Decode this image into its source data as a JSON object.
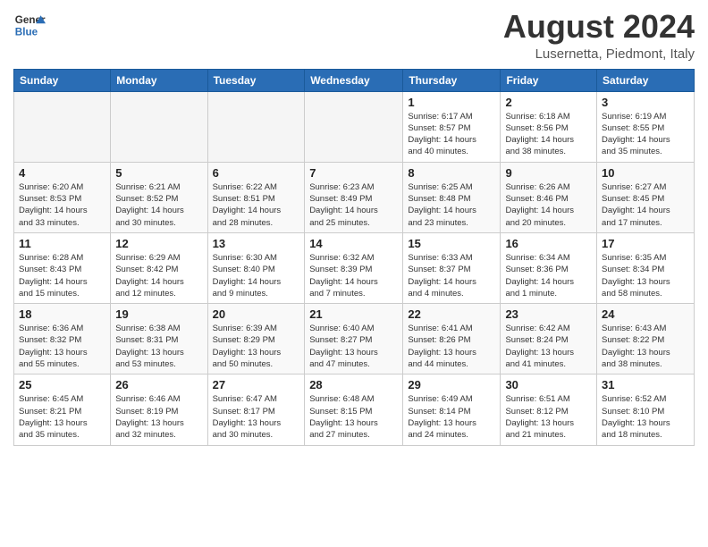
{
  "header": {
    "logo": {
      "line1": "General",
      "line2": "Blue"
    },
    "title": "August 2024",
    "location": "Lusernetta, Piedmont, Italy"
  },
  "weekdays": [
    "Sunday",
    "Monday",
    "Tuesday",
    "Wednesday",
    "Thursday",
    "Friday",
    "Saturday"
  ],
  "weeks": [
    [
      {
        "day": "",
        "info": ""
      },
      {
        "day": "",
        "info": ""
      },
      {
        "day": "",
        "info": ""
      },
      {
        "day": "",
        "info": ""
      },
      {
        "day": "1",
        "info": "Sunrise: 6:17 AM\nSunset: 8:57 PM\nDaylight: 14 hours\nand 40 minutes."
      },
      {
        "day": "2",
        "info": "Sunrise: 6:18 AM\nSunset: 8:56 PM\nDaylight: 14 hours\nand 38 minutes."
      },
      {
        "day": "3",
        "info": "Sunrise: 6:19 AM\nSunset: 8:55 PM\nDaylight: 14 hours\nand 35 minutes."
      }
    ],
    [
      {
        "day": "4",
        "info": "Sunrise: 6:20 AM\nSunset: 8:53 PM\nDaylight: 14 hours\nand 33 minutes."
      },
      {
        "day": "5",
        "info": "Sunrise: 6:21 AM\nSunset: 8:52 PM\nDaylight: 14 hours\nand 30 minutes."
      },
      {
        "day": "6",
        "info": "Sunrise: 6:22 AM\nSunset: 8:51 PM\nDaylight: 14 hours\nand 28 minutes."
      },
      {
        "day": "7",
        "info": "Sunrise: 6:23 AM\nSunset: 8:49 PM\nDaylight: 14 hours\nand 25 minutes."
      },
      {
        "day": "8",
        "info": "Sunrise: 6:25 AM\nSunset: 8:48 PM\nDaylight: 14 hours\nand 23 minutes."
      },
      {
        "day": "9",
        "info": "Sunrise: 6:26 AM\nSunset: 8:46 PM\nDaylight: 14 hours\nand 20 minutes."
      },
      {
        "day": "10",
        "info": "Sunrise: 6:27 AM\nSunset: 8:45 PM\nDaylight: 14 hours\nand 17 minutes."
      }
    ],
    [
      {
        "day": "11",
        "info": "Sunrise: 6:28 AM\nSunset: 8:43 PM\nDaylight: 14 hours\nand 15 minutes."
      },
      {
        "day": "12",
        "info": "Sunrise: 6:29 AM\nSunset: 8:42 PM\nDaylight: 14 hours\nand 12 minutes."
      },
      {
        "day": "13",
        "info": "Sunrise: 6:30 AM\nSunset: 8:40 PM\nDaylight: 14 hours\nand 9 minutes."
      },
      {
        "day": "14",
        "info": "Sunrise: 6:32 AM\nSunset: 8:39 PM\nDaylight: 14 hours\nand 7 minutes."
      },
      {
        "day": "15",
        "info": "Sunrise: 6:33 AM\nSunset: 8:37 PM\nDaylight: 14 hours\nand 4 minutes."
      },
      {
        "day": "16",
        "info": "Sunrise: 6:34 AM\nSunset: 8:36 PM\nDaylight: 14 hours\nand 1 minute."
      },
      {
        "day": "17",
        "info": "Sunrise: 6:35 AM\nSunset: 8:34 PM\nDaylight: 13 hours\nand 58 minutes."
      }
    ],
    [
      {
        "day": "18",
        "info": "Sunrise: 6:36 AM\nSunset: 8:32 PM\nDaylight: 13 hours\nand 55 minutes."
      },
      {
        "day": "19",
        "info": "Sunrise: 6:38 AM\nSunset: 8:31 PM\nDaylight: 13 hours\nand 53 minutes."
      },
      {
        "day": "20",
        "info": "Sunrise: 6:39 AM\nSunset: 8:29 PM\nDaylight: 13 hours\nand 50 minutes."
      },
      {
        "day": "21",
        "info": "Sunrise: 6:40 AM\nSunset: 8:27 PM\nDaylight: 13 hours\nand 47 minutes."
      },
      {
        "day": "22",
        "info": "Sunrise: 6:41 AM\nSunset: 8:26 PM\nDaylight: 13 hours\nand 44 minutes."
      },
      {
        "day": "23",
        "info": "Sunrise: 6:42 AM\nSunset: 8:24 PM\nDaylight: 13 hours\nand 41 minutes."
      },
      {
        "day": "24",
        "info": "Sunrise: 6:43 AM\nSunset: 8:22 PM\nDaylight: 13 hours\nand 38 minutes."
      }
    ],
    [
      {
        "day": "25",
        "info": "Sunrise: 6:45 AM\nSunset: 8:21 PM\nDaylight: 13 hours\nand 35 minutes."
      },
      {
        "day": "26",
        "info": "Sunrise: 6:46 AM\nSunset: 8:19 PM\nDaylight: 13 hours\nand 32 minutes."
      },
      {
        "day": "27",
        "info": "Sunrise: 6:47 AM\nSunset: 8:17 PM\nDaylight: 13 hours\nand 30 minutes."
      },
      {
        "day": "28",
        "info": "Sunrise: 6:48 AM\nSunset: 8:15 PM\nDaylight: 13 hours\nand 27 minutes."
      },
      {
        "day": "29",
        "info": "Sunrise: 6:49 AM\nSunset: 8:14 PM\nDaylight: 13 hours\nand 24 minutes."
      },
      {
        "day": "30",
        "info": "Sunrise: 6:51 AM\nSunset: 8:12 PM\nDaylight: 13 hours\nand 21 minutes."
      },
      {
        "day": "31",
        "info": "Sunrise: 6:52 AM\nSunset: 8:10 PM\nDaylight: 13 hours\nand 18 minutes."
      }
    ]
  ]
}
